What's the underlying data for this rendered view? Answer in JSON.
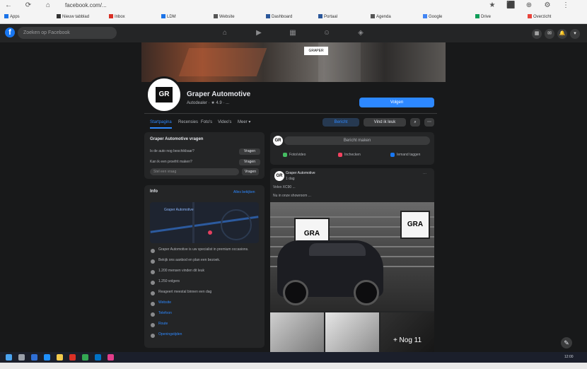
{
  "browser": {
    "nav": [
      "←",
      "⟳",
      "⌂"
    ],
    "address": "facebook.com/...",
    "bookmarks": [
      {
        "label": "Apps",
        "color": "#1a73e8"
      },
      {
        "label": "Nieuw tabblad",
        "color": "#333333"
      },
      {
        "label": "Inbox",
        "color": "#d93025"
      },
      {
        "label": "LDM",
        "color": "#1a73e8"
      },
      {
        "label": "Website",
        "color": "#555555"
      },
      {
        "label": "Dashboard",
        "color": "#2b579a"
      },
      {
        "label": "Portaal",
        "color": "#2b579a"
      },
      {
        "label": "Agenda",
        "color": "#555555"
      },
      {
        "label": "Google",
        "color": "#4285f4"
      },
      {
        "label": "Drive",
        "color": "#0f9d58"
      },
      {
        "label": "Overzicht",
        "color": "#e8453c"
      }
    ],
    "extensions": [
      "★",
      "⬛",
      "⊕",
      "⚙",
      "⋮"
    ]
  },
  "fb": {
    "search_placeholder": "Zoeken op Facebook",
    "nav_icons": [
      "home-icon",
      "video-icon",
      "store-icon",
      "groups-icon",
      "gaming-icon"
    ],
    "nav_glyphs": [
      "⌂",
      "▶",
      "▦",
      "☺",
      "◈"
    ],
    "right_glyphs": [
      "▦",
      "✉",
      "🔔",
      "▾"
    ]
  },
  "page": {
    "name": "Graper Automotive",
    "subtitle": "Autodealer · ★ 4.9 · ...",
    "follow_label": "Volgen",
    "profile_glyph": "GR",
    "cover_badge": "GRAPER",
    "tabs": [
      "Startpagina",
      "Recensies",
      "Foto's",
      "Video's",
      "Meer ▾"
    ],
    "active_tab": 0,
    "message_label": "Bericht",
    "like_label": "Vind ik leuk",
    "search_glyph": "⌕",
    "more_glyph": "⋯"
  },
  "questions": {
    "title": "Graper Automotive vragen",
    "items": [
      {
        "text": "Is de auto nog beschikbaar?",
        "button": "Vragen"
      },
      {
        "text": "Kan ik een proefrit maken?",
        "button": "Vragen"
      }
    ],
    "input_placeholder": "Stel een vraag",
    "send_label": "Vragen"
  },
  "info": {
    "title": "Info",
    "see_all": "Alles bekijken",
    "map_label": "Graper Automotive",
    "rows": [
      "Graper Automotive is uw specialist in premium occasions.",
      "Bekijk ons aanbod en plan een bezoek.",
      "1.200 mensen vinden dit leuk",
      "1.250 volgers",
      "Reageert meestal binnen een dag",
      "Website",
      "Telefoon",
      "Route",
      "Openingstijden"
    ]
  },
  "composer": {
    "placeholder": "Bericht maken",
    "actions": [
      {
        "label": "Foto/video",
        "color": "#45bd62"
      },
      {
        "label": "Inchecken",
        "color": "#f3425f"
      },
      {
        "label": "Iemand taggen",
        "color": "#1877f2"
      }
    ]
  },
  "post": {
    "author": "Graper Automotive",
    "time": "1 dag",
    "line1": "Volvo XC90 ...",
    "line2": "Nu in onze showroom ...",
    "photo_logo": "GRA",
    "more_photos": "+ Nog 11"
  },
  "fab_glyph": "✎",
  "taskbar": {
    "icons": [
      {
        "name": "windows-icon",
        "color": "#4aa3f0"
      },
      {
        "name": "search-icon",
        "color": "#9aa0aa"
      },
      {
        "name": "task-view-icon",
        "color": "#2f6fd6"
      },
      {
        "name": "edge-icon",
        "color": "#1e90ff"
      },
      {
        "name": "explorer-icon",
        "color": "#f2c94c"
      },
      {
        "name": "acrobat-icon",
        "color": "#d93025"
      },
      {
        "name": "chrome-icon",
        "color": "#34a853"
      },
      {
        "name": "outlook-icon",
        "color": "#0072c6"
      },
      {
        "name": "app-icon",
        "color": "#e23d8a"
      }
    ],
    "tray_text": "12:00"
  }
}
